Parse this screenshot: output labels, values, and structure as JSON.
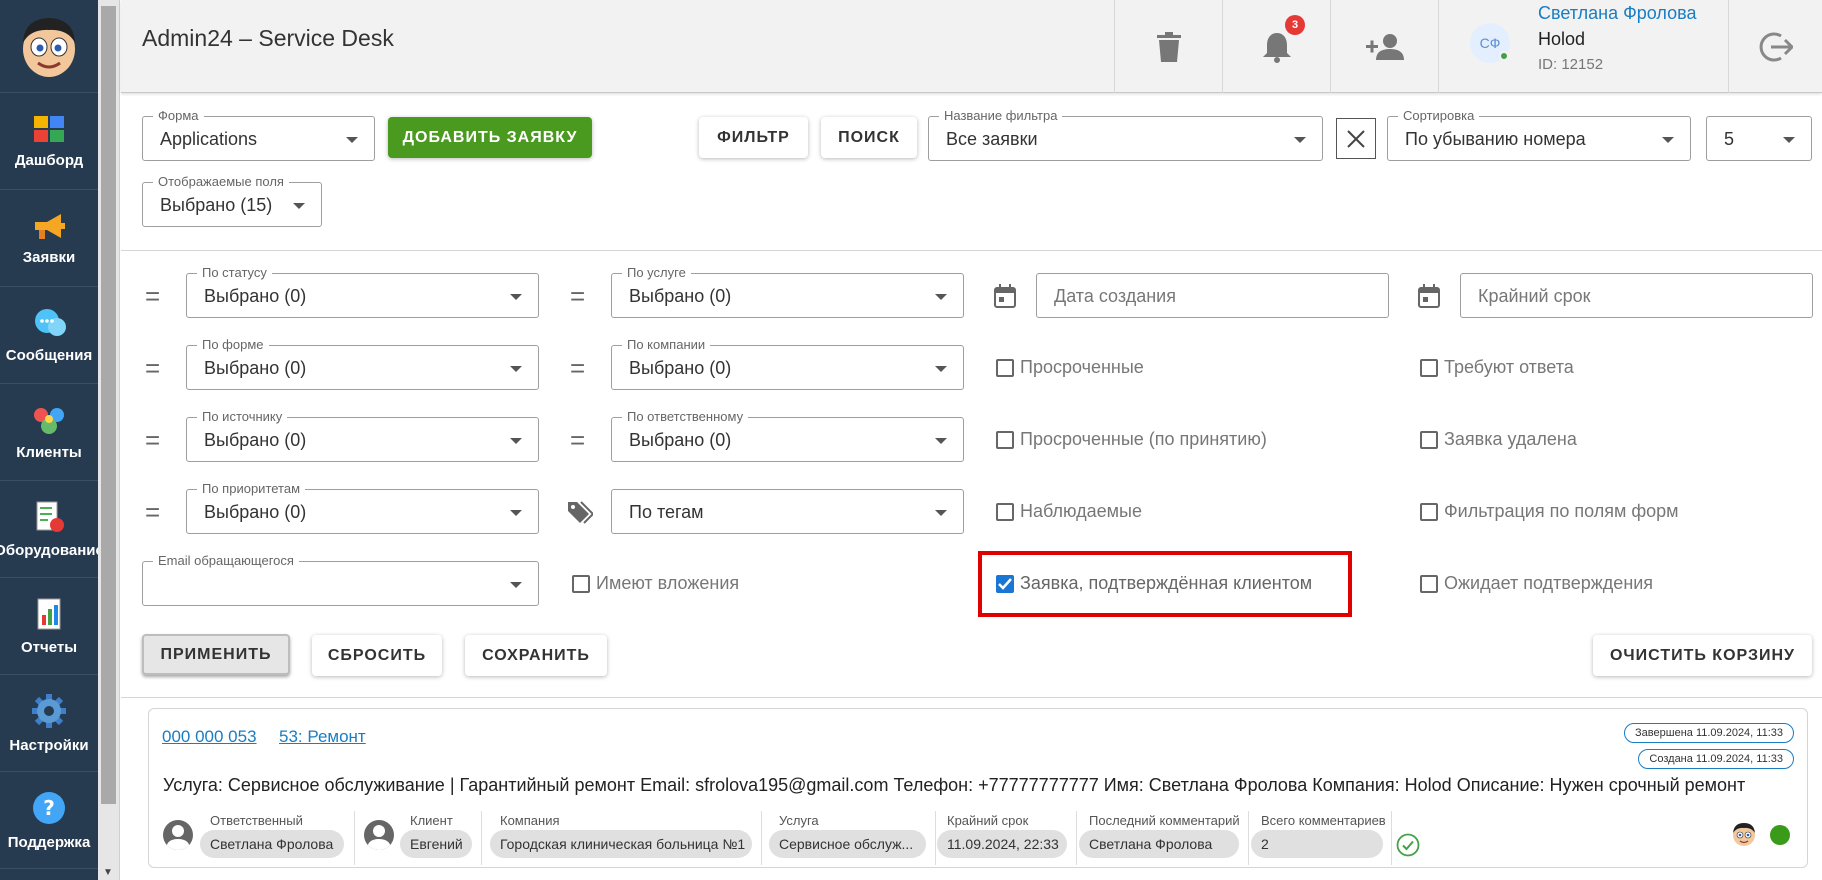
{
  "nav": [
    {
      "label": "Дашборд",
      "icon": "dashboard-icon"
    },
    {
      "label": "Заявки",
      "icon": "megaphone-icon"
    },
    {
      "label": "Сообщения",
      "icon": "chat-icon"
    },
    {
      "label": "Клиенты",
      "icon": "clients-icon"
    },
    {
      "label": "Оборудование",
      "icon": "equipment-icon"
    },
    {
      "label": "Отчеты",
      "icon": "reports-icon"
    },
    {
      "label": "Настройки",
      "icon": "gear-icon"
    },
    {
      "label": "Поддержка",
      "icon": "help-icon"
    }
  ],
  "header": {
    "title": "Admin24 – Service Desk",
    "notification_count": "3",
    "user": {
      "initials": "СФ",
      "name": "Светлана Фролова",
      "company": "Holod",
      "id": "ID: 12152"
    }
  },
  "toolbar": {
    "form": {
      "label": "Форма",
      "value": "Applications"
    },
    "add_button": "ДОБАВИТЬ ЗАЯВКУ",
    "filter_button": "ФИЛЬТР",
    "search_button": "ПОИСК",
    "filter_name": {
      "label": "Название фильтра",
      "value": "Все заявки"
    },
    "sort": {
      "label": "Сортировка",
      "value": "По убыванию номера"
    },
    "page_size": "5",
    "fields": {
      "label": "Отображаемые поля",
      "value": "Выбрано (15)"
    }
  },
  "filters": {
    "status": {
      "label": "По статусу",
      "value": "Выбрано (0)"
    },
    "service": {
      "label": "По услуге",
      "value": "Выбрано (0)"
    },
    "created_date": "Дата создания",
    "deadline": "Крайний срок",
    "form": {
      "label": "По форме",
      "value": "Выбрано (0)"
    },
    "company": {
      "label": "По компании",
      "value": "Выбрано (0)"
    },
    "source": {
      "label": "По источнику",
      "value": "Выбрано (0)"
    },
    "responsible": {
      "label": "По ответственному",
      "value": "Выбрано (0)"
    },
    "priority": {
      "label": "По приоритетам",
      "value": "Выбрано (0)"
    },
    "tags": "По тегам",
    "email": {
      "label": "Email обращающегося",
      "value": ""
    },
    "checkboxes": {
      "overdue": {
        "label": "Просроченные",
        "checked": false
      },
      "need_reply": {
        "label": "Требуют ответа",
        "checked": false
      },
      "overdue_accept": {
        "label": "Просроченные (по принятию)",
        "checked": false
      },
      "deleted": {
        "label": "Заявка удалена",
        "checked": false
      },
      "watched": {
        "label": "Наблюдаемые",
        "checked": false
      },
      "by_form_fields": {
        "label": "Фильтрация по полям форм",
        "checked": false
      },
      "attachments": {
        "label": "Имеют вложения",
        "checked": false
      },
      "confirmed": {
        "label": "Заявка, подтверждённая клиентом",
        "checked": true
      },
      "awaiting": {
        "label": "Ожидает подтверждения",
        "checked": false
      }
    }
  },
  "actions": {
    "apply": "ПРИМЕНИТЬ",
    "reset": "СБРОСИТЬ",
    "save": "СОХРАНИТЬ",
    "clear_trash": "ОЧИСТИТЬ КОРЗИНУ"
  },
  "ticket": {
    "number": "000 000 053",
    "title": "53: Ремонт",
    "status_done": "Завершена 11.09.2024, 11:33",
    "status_created": "Создана 11.09.2024, 11:33",
    "description": "Услуга: Сервисное обслуживание | Гарантийный ремонт Email: sfrolova195@gmail.com Телефон: +77777777777 Имя: Светлана Фролова Компания: Holod Описание: Нужен срочный ремонт",
    "meta": [
      {
        "label": "Ответственный",
        "value": "Светлана Фролова"
      },
      {
        "label": "Клиент",
        "value": "Евгений"
      },
      {
        "label": "Компания",
        "value": "Городская клиническая больница №1"
      },
      {
        "label": "Услуга",
        "value": "Сервисное обслуж..."
      },
      {
        "label": "Крайний срок",
        "value": "11.09.2024, 22:33"
      },
      {
        "label": "Последний комментарий",
        "value": "Светлана Фролова"
      },
      {
        "label": "Всего комментариев",
        "value": "2"
      }
    ]
  },
  "colors": {
    "sidebar": "#263a50",
    "accent": "#1a7dc2",
    "add_button": "#4a9a1f",
    "highlight": "#e00000",
    "online": "#43a047"
  }
}
